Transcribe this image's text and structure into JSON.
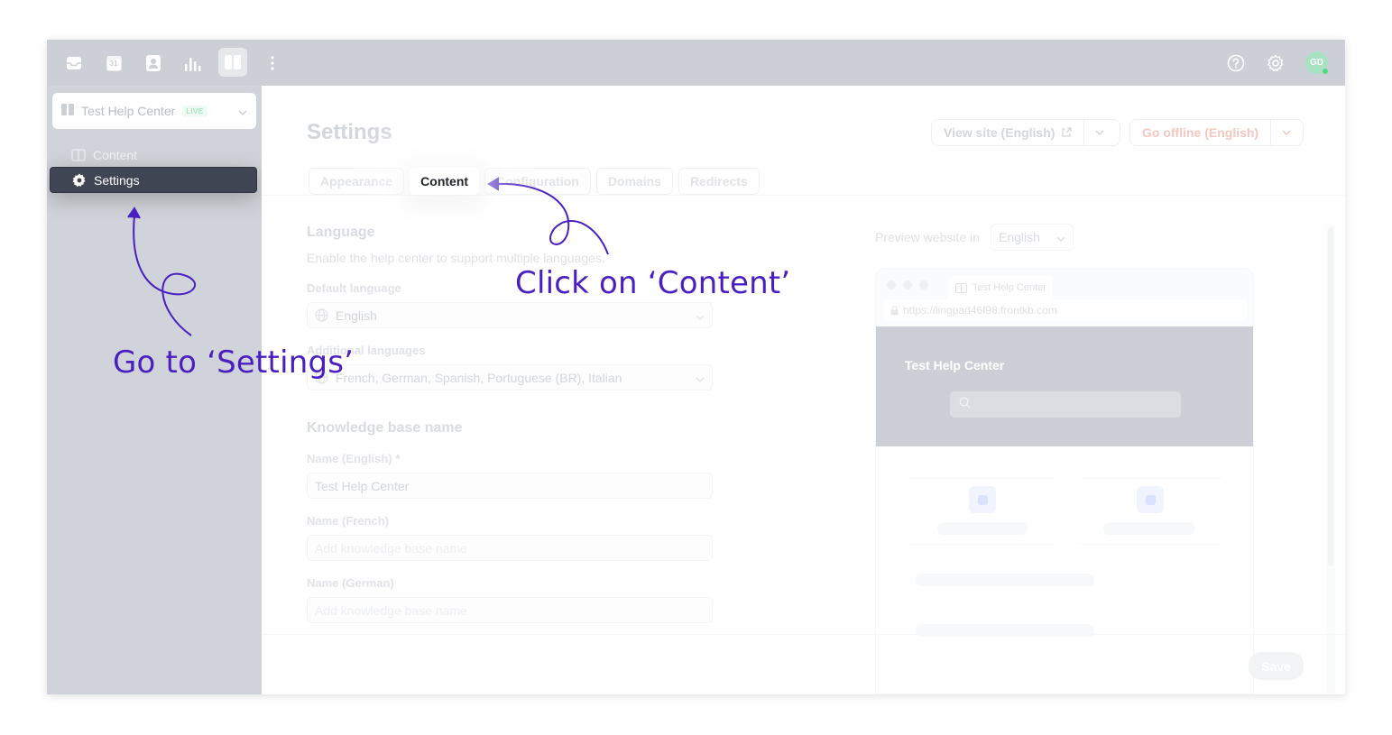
{
  "topbar": {
    "icons": [
      "inbox-icon",
      "calendar-icon",
      "contacts-icon",
      "analytics-icon",
      "knowledge-base-icon",
      "more-icon",
      "help-icon",
      "settings-icon"
    ],
    "calendar_day": "31",
    "avatar_initials": "GD"
  },
  "sidebar": {
    "help_center_name": "Test Help Center",
    "live_badge": "LIVE",
    "items": [
      {
        "label": "Content"
      },
      {
        "label": "Settings"
      }
    ]
  },
  "main": {
    "title": "Settings",
    "view_site_label": "View site (English)",
    "go_offline_label": "Go offline (English)",
    "tabs": [
      {
        "label": "Appearance"
      },
      {
        "label": "Content"
      },
      {
        "label": "Configuration"
      },
      {
        "label": "Domains"
      },
      {
        "label": "Redirects"
      }
    ],
    "language": {
      "title": "Language",
      "description": "Enable the help center to support multiple languages.",
      "default_label": "Default language",
      "default_value": "English",
      "additional_label": "Additional languages",
      "additional_value": "French, German, Spanish, Portuguese (BR), Italian"
    },
    "kb_name": {
      "title": "Knowledge base name",
      "name_english_label": "Name (English) *",
      "name_english_value": "Test Help Center",
      "name_french_label": "Name (French)",
      "name_french_placeholder": "Add knowledge base name",
      "name_german_label": "Name (German)",
      "name_german_placeholder": "Add knowledge base name"
    },
    "preview": {
      "label": "Preview website in",
      "language": "English",
      "tab_title": "Test Help Center",
      "url": "https://lingpad46f98.frontkb.com",
      "hero_title": "Test Help Center"
    },
    "save_label": "Save"
  },
  "annotations": {
    "settings_hint": "Go to ‘Settings’",
    "content_hint": "Click on ‘Content’",
    "color": "#4a1fc2"
  },
  "colors": {
    "topbar": "#ccd0d6",
    "sidebar": "#d0d3d9",
    "active_nav": "#3f4552",
    "live_badge": "#86e0ad",
    "avatar": "#a7e3c3"
  }
}
